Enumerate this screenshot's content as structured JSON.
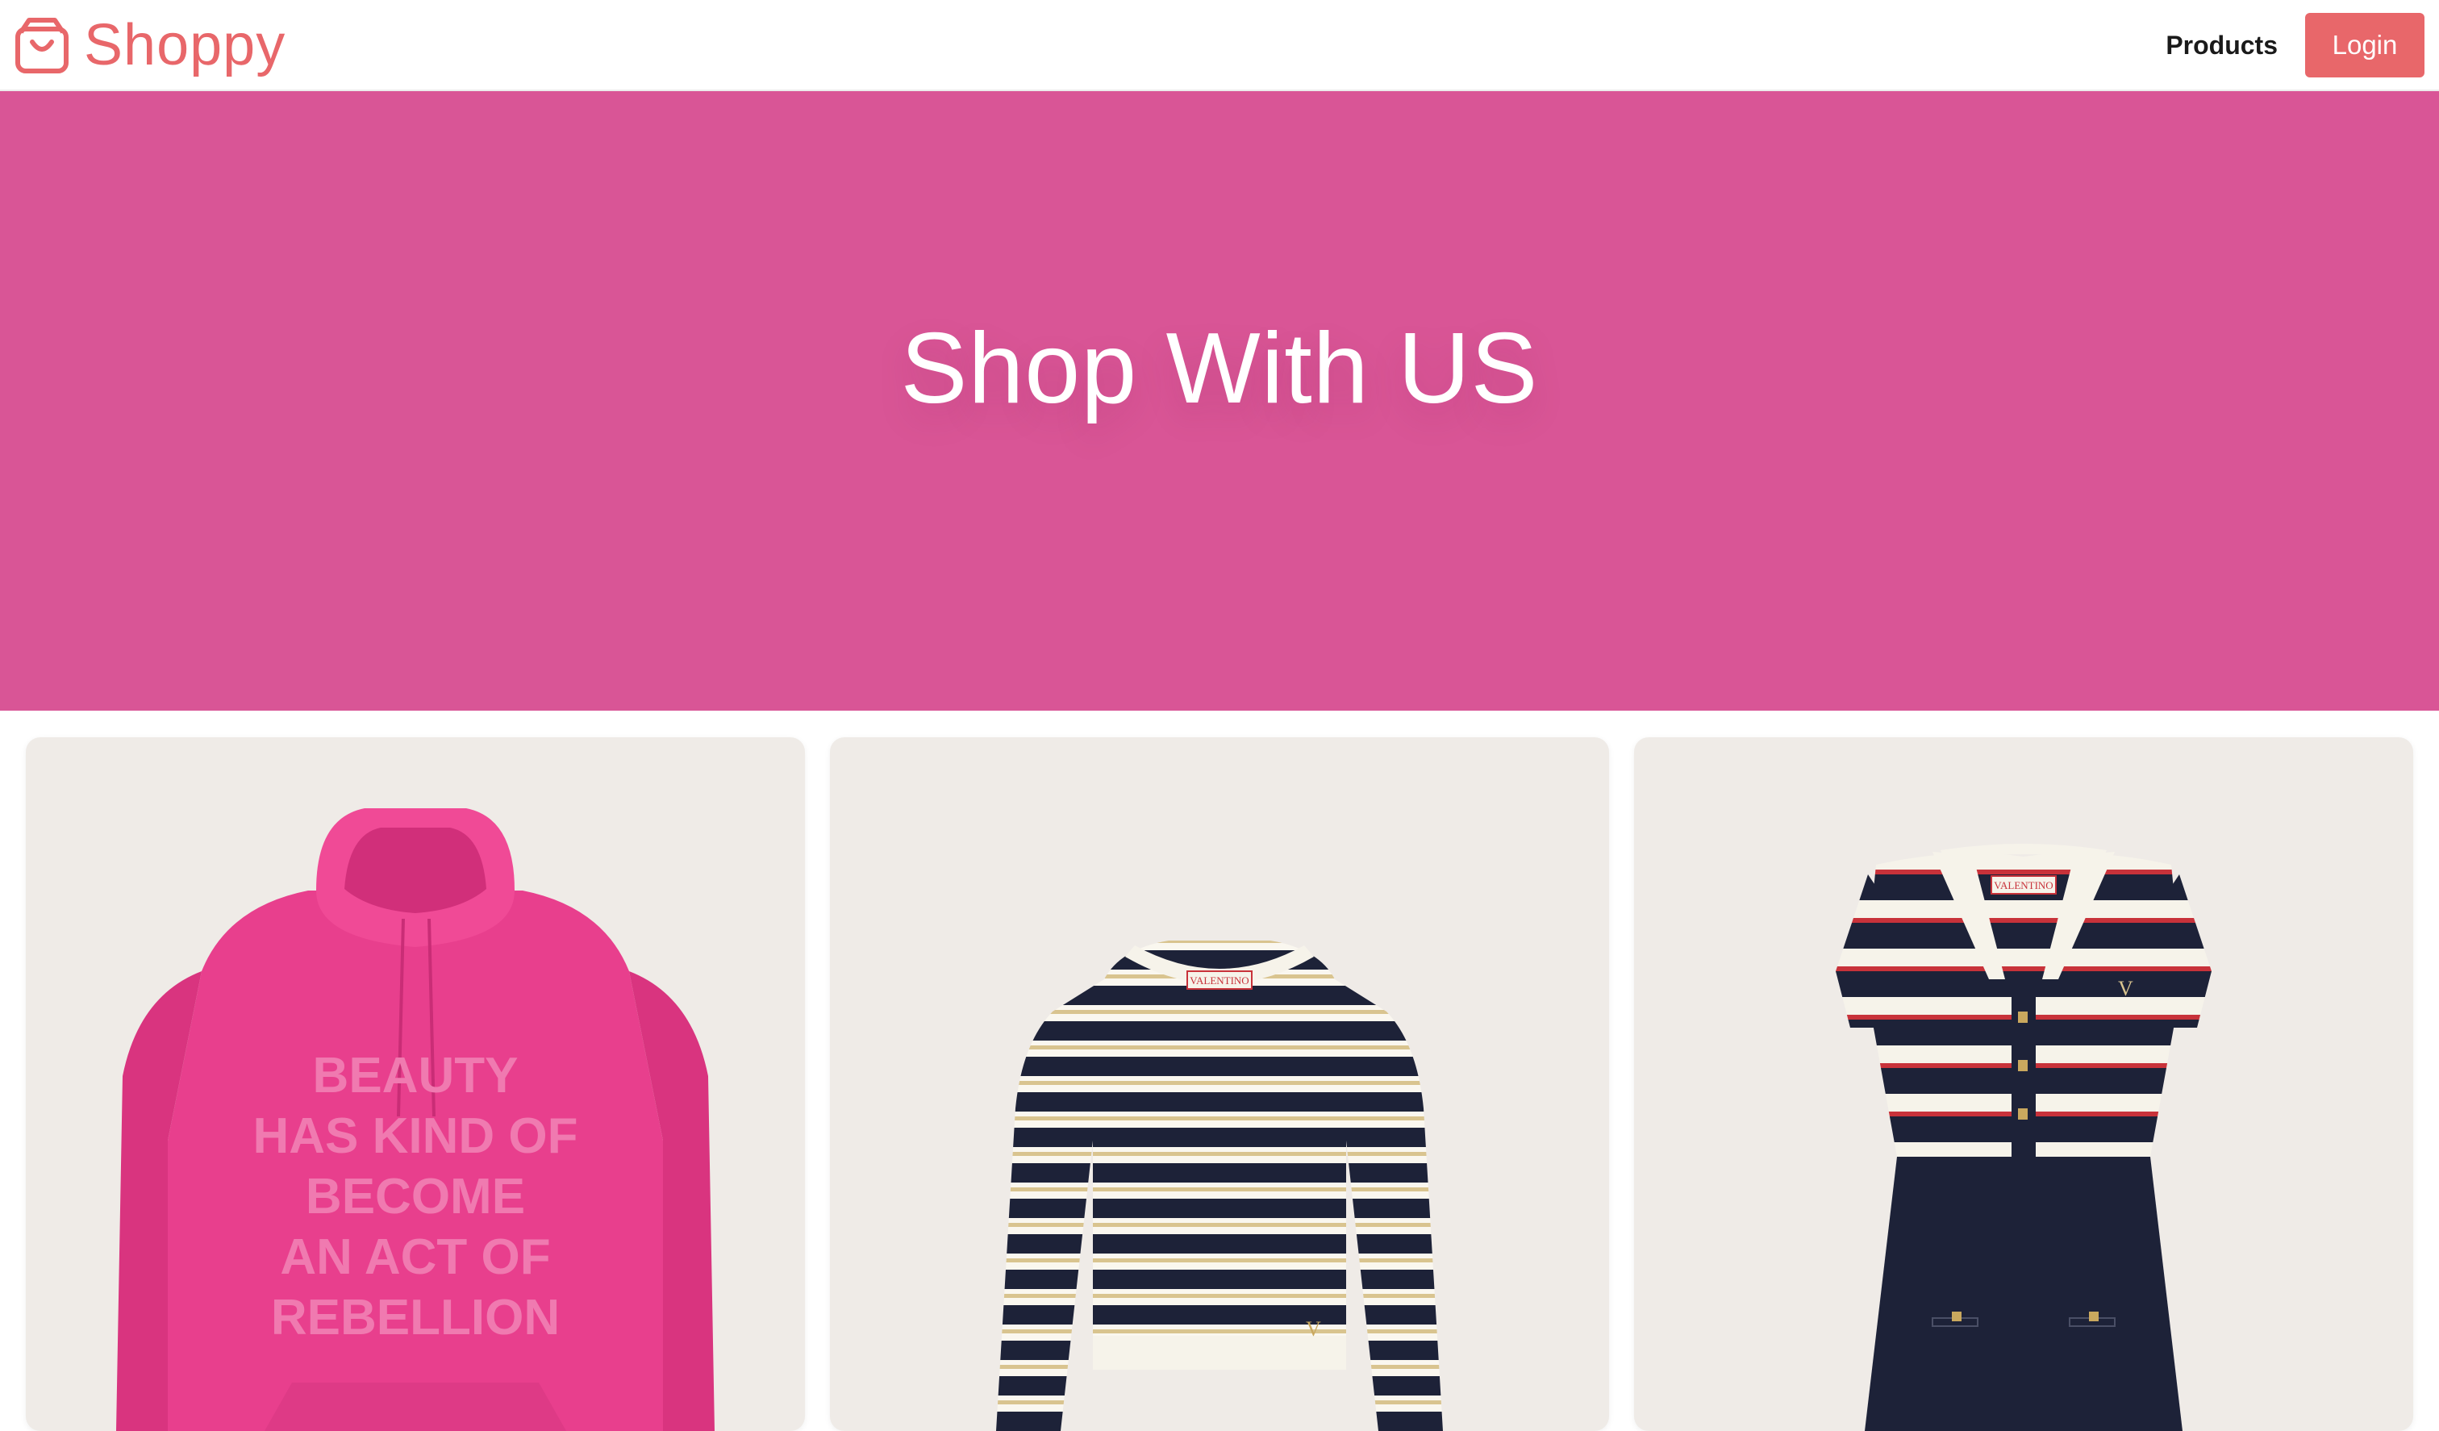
{
  "header": {
    "brand_name": "Shoppy",
    "brand_icon": "shopping-bag-icon",
    "nav": {
      "products_label": "Products",
      "login_label": "Login"
    }
  },
  "hero": {
    "title": "Shop With US"
  },
  "products": [
    {
      "image": "pink-hoodie",
      "print_lines": [
        "BEAUTY",
        "HAS KIND OF",
        "BECOME",
        "AN ACT OF",
        "REBELLION"
      ]
    },
    {
      "image": "striped-cropped-sweater",
      "brand_label": "VALENTINO"
    },
    {
      "image": "striped-polo-dress",
      "brand_label": "VALENTINO"
    }
  ],
  "colors": {
    "accent": "#e8676a",
    "hero_bg": "#d95596",
    "card_bg": "#efebe7",
    "hoodie": "#e83f8d",
    "navy": "#1d2238",
    "red": "#c8323a"
  }
}
